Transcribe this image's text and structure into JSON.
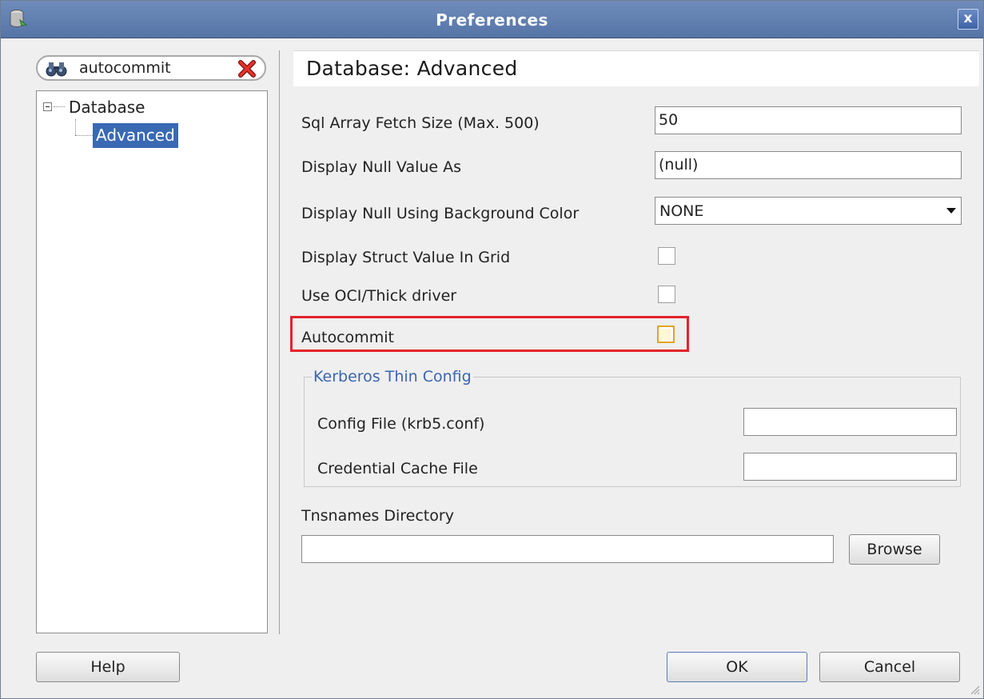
{
  "window": {
    "title": "Preferences",
    "close_label": "x"
  },
  "search": {
    "value": "autocommit"
  },
  "tree": {
    "root_label": "Database",
    "child_label": "Advanced"
  },
  "page": {
    "title": "Database: Advanced"
  },
  "settings": {
    "sql_array_fetch_size": {
      "label": "Sql Array Fetch Size (Max. 500)",
      "value": "50"
    },
    "display_null_value_as": {
      "label": "Display Null Value As",
      "value": "(null)"
    },
    "display_null_bg_color": {
      "label": "Display Null Using Background Color",
      "value": "NONE"
    },
    "display_struct_value": {
      "label": "Display Struct Value In Grid",
      "checked": false
    },
    "use_oci_thick": {
      "label": "Use OCI/Thick driver",
      "checked": false
    },
    "autocommit": {
      "label": "Autocommit",
      "checked": false
    }
  },
  "kerberos": {
    "title": "Kerberos Thin Config",
    "config_file": {
      "label": "Config File (krb5.conf)",
      "value": ""
    },
    "credential_cache": {
      "label": "Credential Cache File",
      "value": ""
    }
  },
  "tnsnames": {
    "label": "Tnsnames Directory",
    "value": "",
    "browse_label": "Browse"
  },
  "buttons": {
    "help": "Help",
    "ok": "OK",
    "cancel": "Cancel"
  },
  "colors": {
    "titlebar": "#5a78ab",
    "selection": "#3a69b4",
    "highlight_box": "#e3232b",
    "group_title": "#3a66b0"
  }
}
